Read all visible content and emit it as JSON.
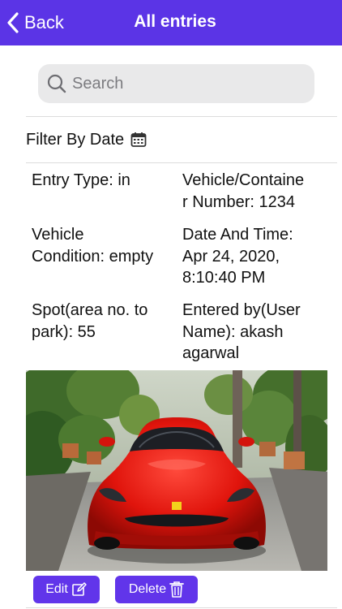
{
  "header": {
    "back_label": "Back",
    "title": "All entries"
  },
  "search": {
    "placeholder": "Search",
    "value": ""
  },
  "filter": {
    "label": "Filter By Date"
  },
  "entry": {
    "entry_type": "Entry Type: in",
    "vehicle_number": "Vehicle/Containe\nr Number: 1234",
    "vehicle_condition": "Vehicle\nCondition: empty",
    "date_time": "Date And Time:\nApr 24, 2020,\n8:10:40 PM",
    "spot": "Spot(area no. to\npark): 55",
    "entered_by": "Entered by(User\nName): akash\nagarwal"
  },
  "actions": {
    "edit_label": "Edit",
    "delete_label": "Delete"
  },
  "colors": {
    "accent": "#5b34e6",
    "button": "#6135ea"
  }
}
